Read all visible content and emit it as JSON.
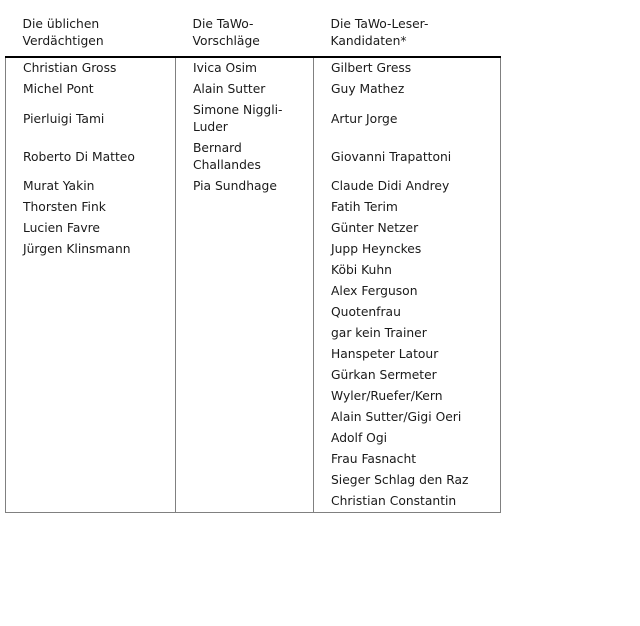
{
  "table": {
    "headers": [
      "Die üblichen\nVerdächtigen",
      "Die TaWo-\nVorschläge",
      "Die TaWo-Leser-\nKandidaten*"
    ],
    "rows": [
      {
        "c1": "Christian Gross",
        "c2": "Ivica Osim",
        "c3": "Gilbert Gress"
      },
      {
        "c1": "Michel Pont",
        "c2": "Alain Sutter",
        "c3": "Guy Mathez"
      },
      {
        "c1": "Pierluigi Tami",
        "c2": "Simone Niggli-\nLuder",
        "c3": "Artur Jorge"
      },
      {
        "c1": "Roberto Di Matteo",
        "c2": "Bernard\nChallandes",
        "c3": "Giovanni Trapattoni"
      },
      {
        "c1": "Murat Yakin",
        "c2": "Pia Sundhage",
        "c3": "Claude Didi Andrey"
      },
      {
        "c1": "Thorsten Fink",
        "c2": "",
        "c3": "Fatih Terim"
      },
      {
        "c1": "Lucien Favre",
        "c2": "",
        "c3": "Günter Netzer"
      },
      {
        "c1": "Jürgen Klinsmann",
        "c2": "",
        "c3": "Jupp Heynckes"
      },
      {
        "c1": "",
        "c2": "",
        "c3": "Köbi Kuhn"
      },
      {
        "c1": "",
        "c2": "",
        "c3": "Alex Ferguson"
      },
      {
        "c1": "",
        "c2": "",
        "c3": "Quotenfrau"
      },
      {
        "c1": "",
        "c2": "",
        "c3": "gar kein Trainer"
      },
      {
        "c1": "",
        "c2": "",
        "c3": "Hanspeter Latour"
      },
      {
        "c1": "",
        "c2": "",
        "c3": "Gürkan Sermeter"
      },
      {
        "c1": "",
        "c2": "",
        "c3": "Wyler/Ruefer/Kern"
      },
      {
        "c1": "",
        "c2": "",
        "c3": "Alain Sutter/Gigi Oeri"
      },
      {
        "c1": "",
        "c2": "",
        "c3": "Adolf Ogi"
      },
      {
        "c1": "",
        "c2": "",
        "c3": "Frau Fasnacht"
      },
      {
        "c1": "",
        "c2": "",
        "c3": "Sieger Schlag den Raz"
      },
      {
        "c1": "",
        "c2": "",
        "c3": "Christian Constantin"
      }
    ]
  },
  "colors": {
    "text": "#1a1a1a",
    "header_rule": "#000000",
    "grid": "#808080",
    "background": "#ffffff"
  }
}
